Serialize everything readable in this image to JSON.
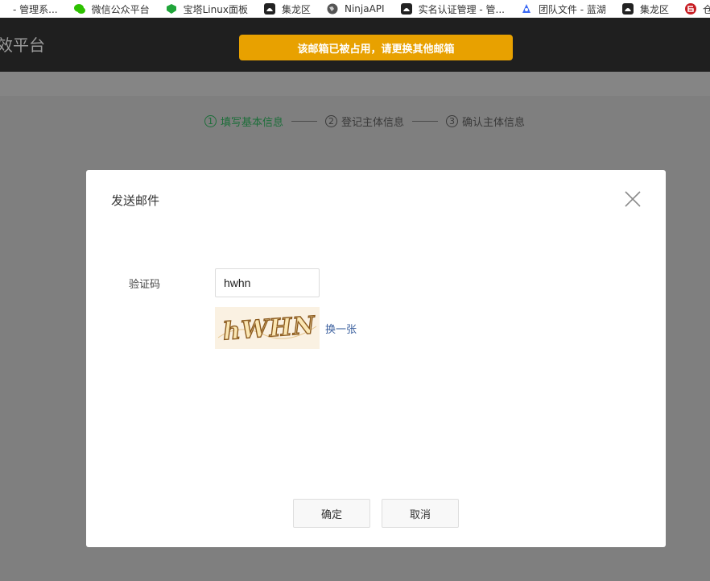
{
  "bookmarks": [
    {
      "label": "- 管理系...",
      "icon": "page-icon"
    },
    {
      "label": "微信公众平台",
      "icon": "wechat-icon"
    },
    {
      "label": "宝塔Linux面板",
      "icon": "bt-panel-icon"
    },
    {
      "label": "集龙区",
      "icon": "dark-app-icon"
    },
    {
      "label": "NinjaAPI",
      "icon": "globe-icon"
    },
    {
      "label": "实名认证管理 - 管...",
      "icon": "dark-app-icon"
    },
    {
      "label": "团队文件 - 蓝湖",
      "icon": "lanhu-icon"
    },
    {
      "label": "集龙区",
      "icon": "dark-app-icon"
    },
    {
      "label": "仓库 - ...",
      "icon": "gitee-icon"
    }
  ],
  "header": {
    "brand": "效平台"
  },
  "toast": {
    "message": "该邮箱已被占用，请更换其他邮箱"
  },
  "steps": [
    {
      "num": "1",
      "label": "填写基本信息",
      "active": true
    },
    {
      "num": "2",
      "label": "登记主体信息",
      "active": false
    },
    {
      "num": "3",
      "label": "确认主体信息",
      "active": false
    }
  ],
  "modal": {
    "title": "发送邮件",
    "captcha_label": "验证码",
    "captcha_value": "hwhn",
    "captcha_image_text": "hWHN",
    "refresh_label": "换一张",
    "confirm_label": "确定",
    "cancel_label": "取消"
  },
  "colors": {
    "toast_bg": "#e8a100",
    "active_step": "#1d6e3a",
    "link": "#3a5f9e"
  }
}
